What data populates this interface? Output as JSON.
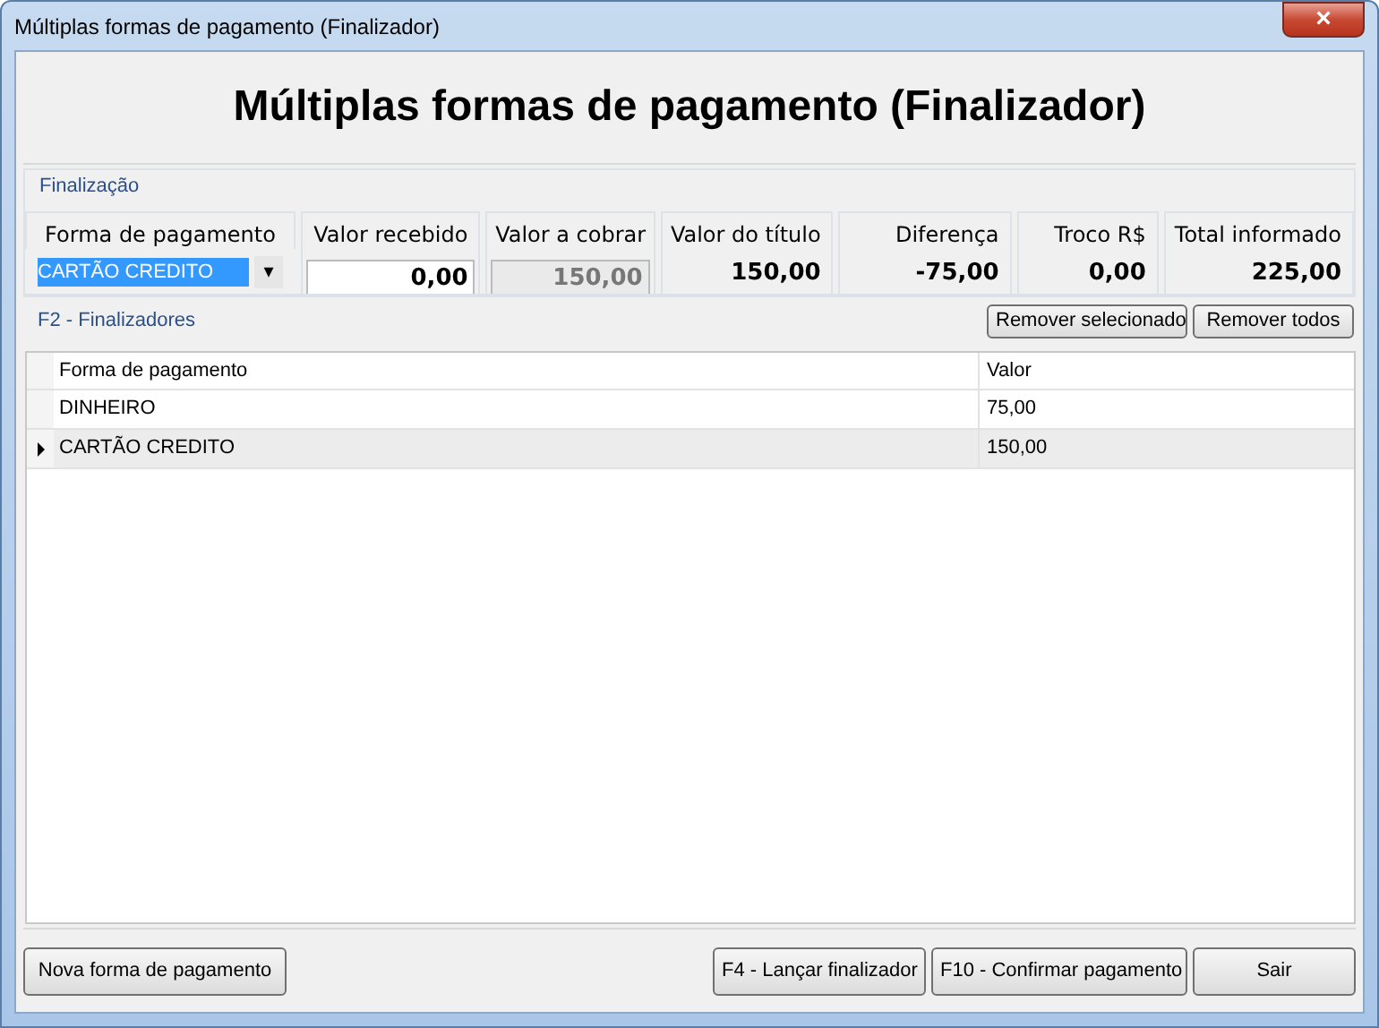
{
  "window": {
    "title": "Múltiplas formas de pagamento (Finalizador)",
    "close": "×"
  },
  "header": {
    "title": "Múltiplas formas de pagamento (Finalizador)"
  },
  "finalizacao": {
    "label": "Finalização",
    "fields": [
      {
        "kind": "combo",
        "label": "Forma de pagamento",
        "value": "CARTÃO CREDITO",
        "arrow": "▾"
      },
      {
        "kind": "input",
        "label": "Valor recebido",
        "value": "0,00"
      },
      {
        "kind": "readonly",
        "label": "Valor a cobrar",
        "value": "150,00"
      },
      {
        "kind": "display",
        "label": "Valor do título",
        "value": "150,00"
      },
      {
        "kind": "display",
        "label": "Diferença",
        "value": "-75,00"
      },
      {
        "kind": "display",
        "label": "Troco R$",
        "value": "0,00"
      },
      {
        "kind": "display",
        "label": "Total informado",
        "value": "225,00"
      }
    ]
  },
  "finalizadores": {
    "label": "F2 - Finalizadores",
    "buttons": [
      "Remover selecionado",
      "Remover todos"
    ],
    "table": {
      "columns": [
        "Forma de pagamento",
        "Valor"
      ],
      "rows": [
        {
          "cells": [
            "DINHEIRO",
            "75,00"
          ],
          "selected": false
        },
        {
          "cells": [
            "CARTÃO CREDITO",
            "150,00"
          ],
          "selected": true
        }
      ]
    }
  },
  "footer": {
    "left_button": "Nova forma de pagamento",
    "buttons": [
      "F4 - Lançar finalizador",
      "F10 - Confirmar pagamento",
      "Sair"
    ]
  }
}
